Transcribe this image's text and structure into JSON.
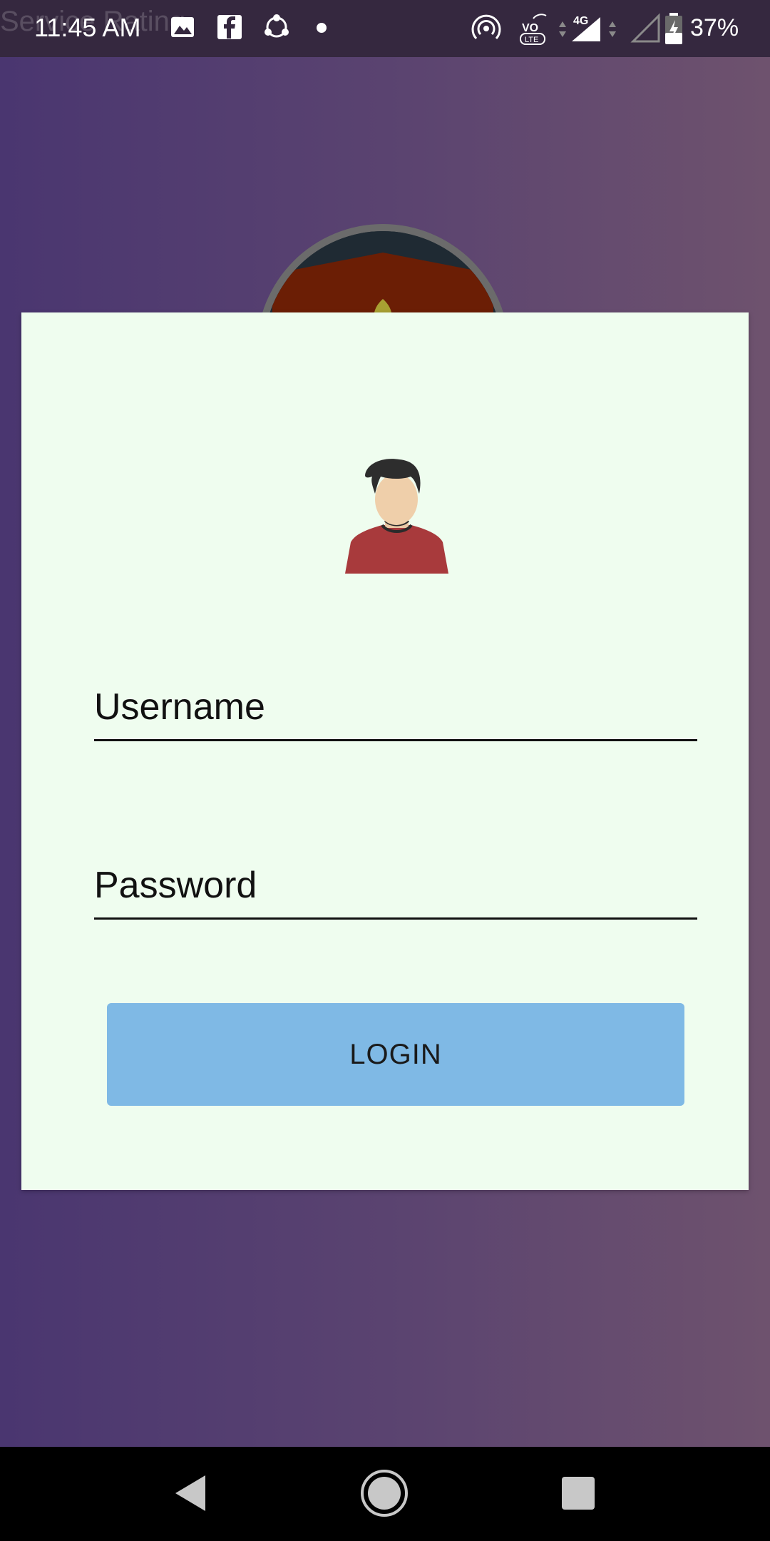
{
  "status_bar": {
    "background_app_title": "Service Rating",
    "time": "11:45 AM",
    "network_label": "4G",
    "volte_label": "VO LTE",
    "battery_percent": "37%"
  },
  "login_form": {
    "username_placeholder": "Username",
    "username_value": "",
    "password_placeholder": "Password",
    "password_value": "",
    "login_label": "LOGIN"
  },
  "colors": {
    "background_start": "#4a3670",
    "background_end": "#6e526e",
    "card": "#effdef",
    "login_button": "#7fb9e5"
  }
}
